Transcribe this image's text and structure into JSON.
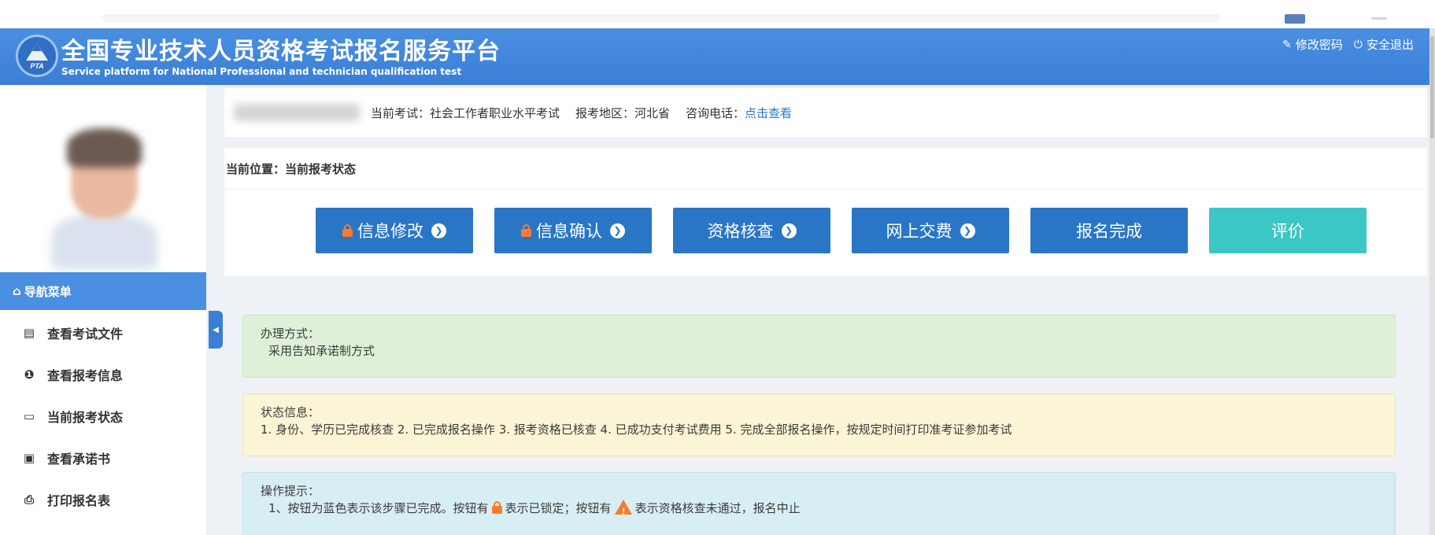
{
  "header": {
    "title": "全国专业技术人员资格考试报名服务平台",
    "subtitle": "Service platform for National Professional and technician qualification test",
    "logo_text": "PTA",
    "links": [
      {
        "label": "修改密码",
        "icon": "edit-icon"
      },
      {
        "label": "安全退出",
        "icon": "power-icon"
      }
    ]
  },
  "sidebar": {
    "nav_title": "导航菜单",
    "items": [
      {
        "label": "查看考试文件",
        "icon": "file-icon"
      },
      {
        "label": "查看报考信息",
        "icon": "info-circle-icon"
      },
      {
        "label": "当前报考状态",
        "icon": "monitor-icon"
      },
      {
        "label": "查看承诺书",
        "icon": "id-card-icon"
      },
      {
        "label": "打印报名表",
        "icon": "print-icon"
      }
    ]
  },
  "exam_info": {
    "exam": "当前考试：社会工作者职业水平考试",
    "region": "报考地区：河北省",
    "phone_label": "咨询电话：",
    "phone_link": "点击查看"
  },
  "status": {
    "breadcrumb": "当前位置：当前报考状态",
    "steps": [
      {
        "label": "信息修改",
        "locked": true,
        "arrow": true
      },
      {
        "label": "信息确认",
        "locked": true,
        "arrow": true
      },
      {
        "label": "资格核查",
        "locked": false,
        "arrow": true
      },
      {
        "label": "网上交费",
        "locked": false,
        "arrow": true
      },
      {
        "label": "报名完成",
        "locked": false,
        "arrow": false
      },
      {
        "label": "评价",
        "locked": false,
        "arrow": false
      }
    ]
  },
  "panels": {
    "method": {
      "title": "办理方式：",
      "body": "采用告知承诺制方式"
    },
    "state": {
      "title": "状态信息：",
      "body": "1. 身份、学历已完成核查 2. 已完成报名操作 3. 报考资格已核查 4. 已成功支付考试费用 5. 完成全部报名操作，按规定时间打印准考证参加考试"
    },
    "tips": {
      "title": "操作提示：",
      "line_a": "1、按钮为蓝色表示该步骤已完成。按钮有",
      "line_b": "表示已锁定；按钮有",
      "line_c": "表示资格核查未通过，报名中止"
    }
  },
  "colors": {
    "primary": "#2a76c6",
    "header": "#4a8fe1",
    "teal": "#3cc6c6",
    "lock": "#ff7a2a"
  }
}
